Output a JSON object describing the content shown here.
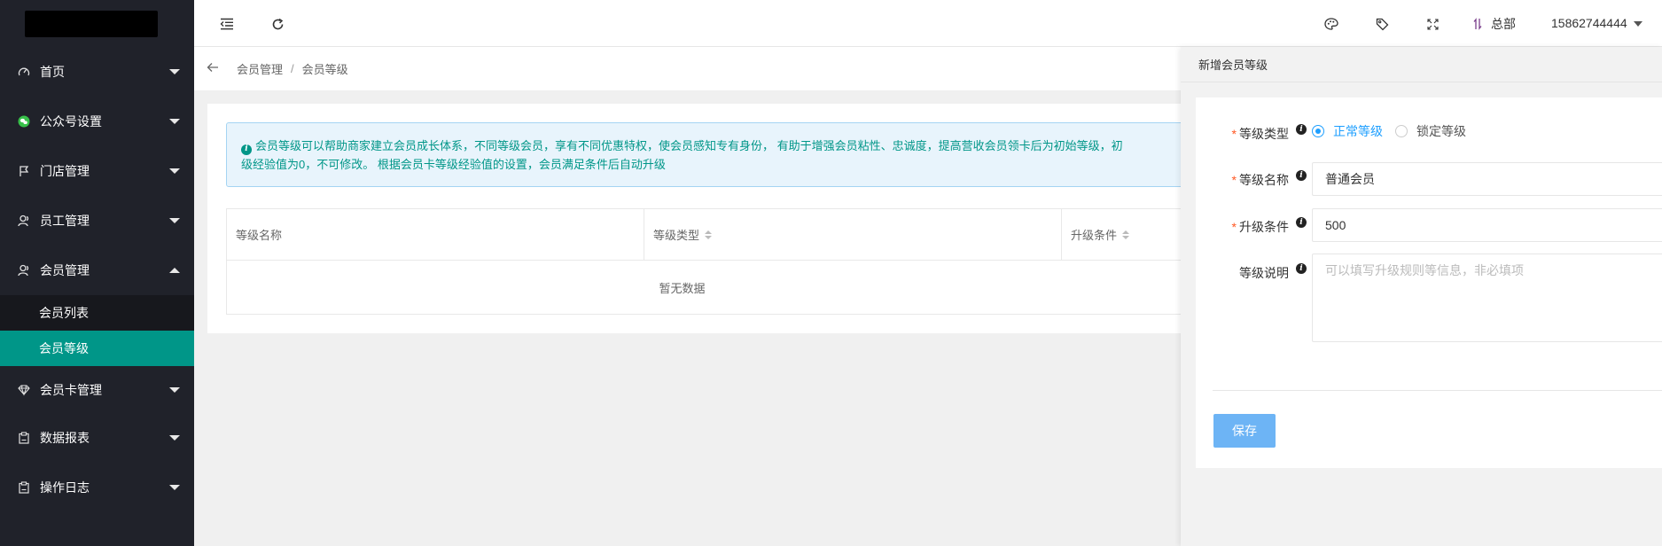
{
  "sidebar": {
    "items": [
      {
        "label": "首页",
        "icon": "dashboard-icon"
      },
      {
        "label": "公众号设置",
        "icon": "wechat-icon"
      },
      {
        "label": "门店管理",
        "icon": "flag-icon"
      },
      {
        "label": "员工管理",
        "icon": "user-icon"
      },
      {
        "label": "会员管理",
        "icon": "user-icon"
      },
      {
        "label": "会员卡管理",
        "icon": "diamond-icon"
      },
      {
        "label": "数据报表",
        "icon": "clipboard-icon"
      },
      {
        "label": "操作日志",
        "icon": "clipboard-icon"
      }
    ],
    "member_sub": [
      {
        "label": "会员列表"
      },
      {
        "label": "会员等级"
      }
    ],
    "active_color": "#009688"
  },
  "header": {
    "store": "总部",
    "phone": "15862744444"
  },
  "breadcrumb": {
    "parent": "会员管理",
    "separator": "/",
    "current": "会员等级"
  },
  "tip": {
    "line1": "会员等级可以帮助商家建立会员成长体系，不同等级会员，享有不同优惠特权，使会员感知专有身份， 有助于增强会员粘性、忠诚度，提高营收会员领卡后为初始等级，初",
    "line2": "级经验值为0，不可修改。 根据会员卡等级经验值的设置，会员满足条件后自动升级"
  },
  "table": {
    "columns": [
      "等级名称",
      "等级类型",
      "升级条件"
    ],
    "empty_text": "暂无数据"
  },
  "drawer": {
    "title": "新增会员等级",
    "type_label": "等级类型",
    "type_options": [
      "正常等级",
      "锁定等级"
    ],
    "type_selected": "正常等级",
    "name_label": "等级名称",
    "name_value": "普通会员",
    "cond_label": "升级条件",
    "cond_value": "500",
    "desc_label": "等级说明",
    "desc_placeholder": "可以填写升级规则等信息，非必填项",
    "save_label": "保存"
  }
}
